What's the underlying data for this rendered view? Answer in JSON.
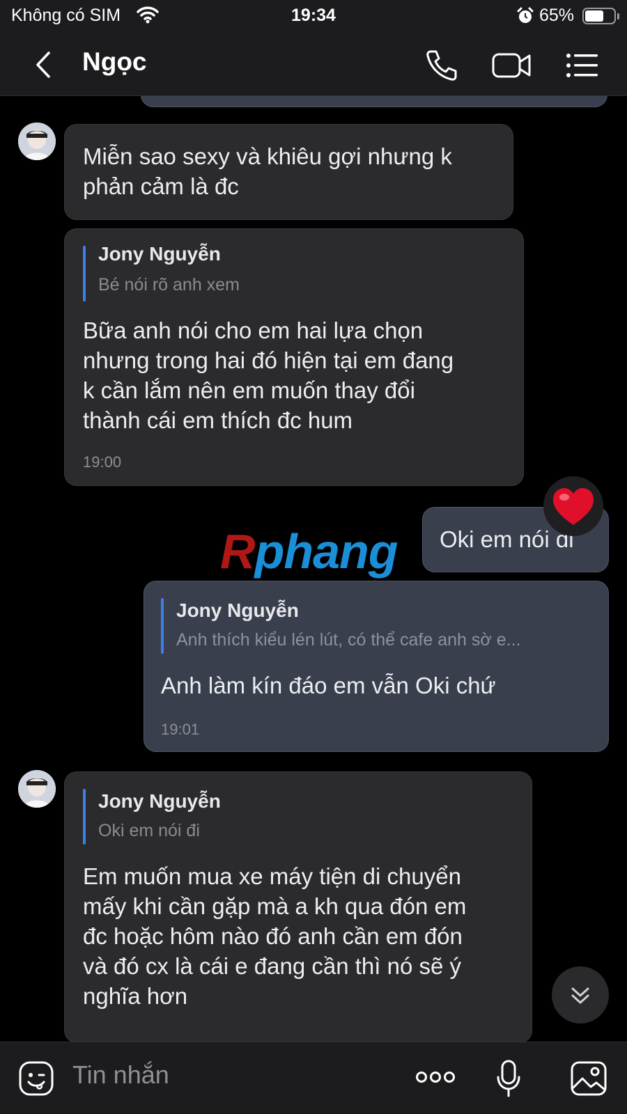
{
  "status_bar": {
    "carrier": "Không có SIM",
    "time": "19:34",
    "battery": "65%",
    "battery_level": 0.65,
    "icons": [
      "wifi-icon",
      "alarm-icon",
      "battery-icon"
    ]
  },
  "header": {
    "contact_name": "Ngọc",
    "icons": [
      "back-chevron-icon",
      "phone-icon",
      "video-camera-icon",
      "menu-list-icon"
    ]
  },
  "messages": [
    {
      "direction": "incoming",
      "text_lines": [
        "Miễn sao sexy và khiêu gợi nhưng k",
        "phản cảm là đc"
      ]
    },
    {
      "direction": "incoming",
      "quote": {
        "name": "Jony Nguyễn",
        "text": "Bé nói rõ anh xem"
      },
      "text_lines": [
        "Bữa anh nói cho em hai lựa chọn",
        "nhưng trong hai đó hiện tại em đang",
        "k cần lắm nên em muốn thay đổi",
        "thành cái em thích đc hum"
      ],
      "time": "19:00"
    },
    {
      "direction": "outgoing",
      "text_lines": [
        "Oki em nói đi"
      ],
      "reaction": "heart-icon"
    },
    {
      "direction": "outgoing",
      "quote": {
        "name": "Jony Nguyễn",
        "text": "Anh thích kiểu lén lút, có thể cafe anh sờ e..."
      },
      "text_lines": [
        "Anh làm kín đáo em vẫn Oki chứ"
      ],
      "time": "19:01"
    },
    {
      "direction": "incoming",
      "quote": {
        "name": "Jony Nguyễn",
        "text": "Oki em nói đi"
      },
      "text_lines": [
        "Em muốn mua xe máy tiện di chuyển",
        "mấy khi cần gặp mà a kh qua đón em",
        "đc hoặc hôm nào đó anh cần em đón",
        "và đó cx là cái e đang cần thì nó sẽ ý",
        "nghĩa hơn"
      ]
    }
  ],
  "watermark": {
    "first": "R",
    "rest": "phang"
  },
  "input_bar": {
    "placeholder": "Tin nhắn",
    "icons": [
      "sticker-face-icon",
      "more-dots-icon",
      "microphone-icon",
      "image-icon"
    ]
  },
  "colors": {
    "background": "#000000",
    "bar": "#1c1c1e",
    "incoming_bubble": "#2b2b2e",
    "outgoing_bubble": "#3a3f4e",
    "quote_accent": "#3d7fe6"
  }
}
